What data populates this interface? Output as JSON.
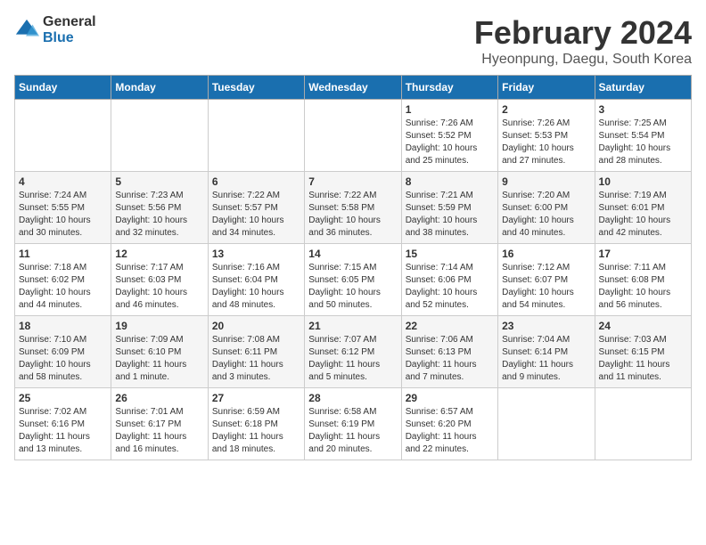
{
  "header": {
    "logo_general": "General",
    "logo_blue": "Blue",
    "month_year": "February 2024",
    "location": "Hyeonpung, Daegu, South Korea"
  },
  "days_of_week": [
    "Sunday",
    "Monday",
    "Tuesday",
    "Wednesday",
    "Thursday",
    "Friday",
    "Saturday"
  ],
  "weeks": [
    [
      {
        "day": "",
        "info": ""
      },
      {
        "day": "",
        "info": ""
      },
      {
        "day": "",
        "info": ""
      },
      {
        "day": "",
        "info": ""
      },
      {
        "day": "1",
        "info": "Sunrise: 7:26 AM\nSunset: 5:52 PM\nDaylight: 10 hours\nand 25 minutes."
      },
      {
        "day": "2",
        "info": "Sunrise: 7:26 AM\nSunset: 5:53 PM\nDaylight: 10 hours\nand 27 minutes."
      },
      {
        "day": "3",
        "info": "Sunrise: 7:25 AM\nSunset: 5:54 PM\nDaylight: 10 hours\nand 28 minutes."
      }
    ],
    [
      {
        "day": "4",
        "info": "Sunrise: 7:24 AM\nSunset: 5:55 PM\nDaylight: 10 hours\nand 30 minutes."
      },
      {
        "day": "5",
        "info": "Sunrise: 7:23 AM\nSunset: 5:56 PM\nDaylight: 10 hours\nand 32 minutes."
      },
      {
        "day": "6",
        "info": "Sunrise: 7:22 AM\nSunset: 5:57 PM\nDaylight: 10 hours\nand 34 minutes."
      },
      {
        "day": "7",
        "info": "Sunrise: 7:22 AM\nSunset: 5:58 PM\nDaylight: 10 hours\nand 36 minutes."
      },
      {
        "day": "8",
        "info": "Sunrise: 7:21 AM\nSunset: 5:59 PM\nDaylight: 10 hours\nand 38 minutes."
      },
      {
        "day": "9",
        "info": "Sunrise: 7:20 AM\nSunset: 6:00 PM\nDaylight: 10 hours\nand 40 minutes."
      },
      {
        "day": "10",
        "info": "Sunrise: 7:19 AM\nSunset: 6:01 PM\nDaylight: 10 hours\nand 42 minutes."
      }
    ],
    [
      {
        "day": "11",
        "info": "Sunrise: 7:18 AM\nSunset: 6:02 PM\nDaylight: 10 hours\nand 44 minutes."
      },
      {
        "day": "12",
        "info": "Sunrise: 7:17 AM\nSunset: 6:03 PM\nDaylight: 10 hours\nand 46 minutes."
      },
      {
        "day": "13",
        "info": "Sunrise: 7:16 AM\nSunset: 6:04 PM\nDaylight: 10 hours\nand 48 minutes."
      },
      {
        "day": "14",
        "info": "Sunrise: 7:15 AM\nSunset: 6:05 PM\nDaylight: 10 hours\nand 50 minutes."
      },
      {
        "day": "15",
        "info": "Sunrise: 7:14 AM\nSunset: 6:06 PM\nDaylight: 10 hours\nand 52 minutes."
      },
      {
        "day": "16",
        "info": "Sunrise: 7:12 AM\nSunset: 6:07 PM\nDaylight: 10 hours\nand 54 minutes."
      },
      {
        "day": "17",
        "info": "Sunrise: 7:11 AM\nSunset: 6:08 PM\nDaylight: 10 hours\nand 56 minutes."
      }
    ],
    [
      {
        "day": "18",
        "info": "Sunrise: 7:10 AM\nSunset: 6:09 PM\nDaylight: 10 hours\nand 58 minutes."
      },
      {
        "day": "19",
        "info": "Sunrise: 7:09 AM\nSunset: 6:10 PM\nDaylight: 11 hours\nand 1 minute."
      },
      {
        "day": "20",
        "info": "Sunrise: 7:08 AM\nSunset: 6:11 PM\nDaylight: 11 hours\nand 3 minutes."
      },
      {
        "day": "21",
        "info": "Sunrise: 7:07 AM\nSunset: 6:12 PM\nDaylight: 11 hours\nand 5 minutes."
      },
      {
        "day": "22",
        "info": "Sunrise: 7:06 AM\nSunset: 6:13 PM\nDaylight: 11 hours\nand 7 minutes."
      },
      {
        "day": "23",
        "info": "Sunrise: 7:04 AM\nSunset: 6:14 PM\nDaylight: 11 hours\nand 9 minutes."
      },
      {
        "day": "24",
        "info": "Sunrise: 7:03 AM\nSunset: 6:15 PM\nDaylight: 11 hours\nand 11 minutes."
      }
    ],
    [
      {
        "day": "25",
        "info": "Sunrise: 7:02 AM\nSunset: 6:16 PM\nDaylight: 11 hours\nand 13 minutes."
      },
      {
        "day": "26",
        "info": "Sunrise: 7:01 AM\nSunset: 6:17 PM\nDaylight: 11 hours\nand 16 minutes."
      },
      {
        "day": "27",
        "info": "Sunrise: 6:59 AM\nSunset: 6:18 PM\nDaylight: 11 hours\nand 18 minutes."
      },
      {
        "day": "28",
        "info": "Sunrise: 6:58 AM\nSunset: 6:19 PM\nDaylight: 11 hours\nand 20 minutes."
      },
      {
        "day": "29",
        "info": "Sunrise: 6:57 AM\nSunset: 6:20 PM\nDaylight: 11 hours\nand 22 minutes."
      },
      {
        "day": "",
        "info": ""
      },
      {
        "day": "",
        "info": ""
      }
    ]
  ]
}
